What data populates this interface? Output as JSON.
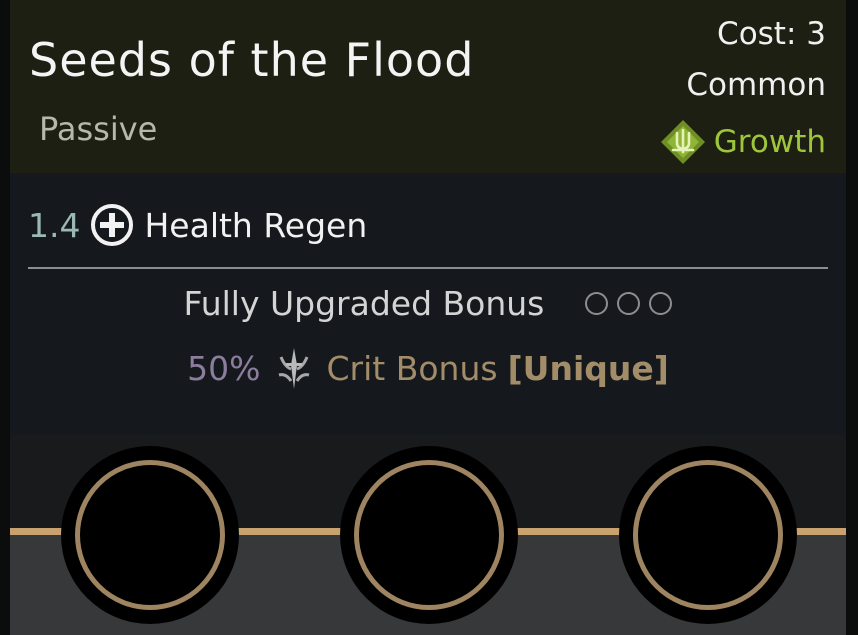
{
  "card": {
    "title": "Seeds of the Flood",
    "subtitle": "Passive",
    "cost": "Cost: 3",
    "rarity": "Common",
    "category": "Growth",
    "category_icon": "growth-icon"
  },
  "stat": {
    "value": "1.4",
    "label": "Health Regen",
    "icon": "health-plus-icon"
  },
  "bonus": {
    "title": "Fully Upgraded Bonus",
    "upgrades_total": 3,
    "upgrades_filled": 0,
    "value": "50%",
    "label": "Crit Bonus",
    "tag": "[Unique]",
    "icon": "crit-icon"
  },
  "slots": [
    {
      "name": "upgrade-slot-1"
    },
    {
      "name": "upgrade-slot-2"
    },
    {
      "name": "upgrade-slot-3"
    }
  ],
  "colors": {
    "header_bg": "#1d1f12",
    "body_bg": "#15191d",
    "growth_green": "#9fc63a",
    "stat_value": "#9cb8b4",
    "bonus_value": "#8d7d9c",
    "bonus_text": "#a38d68",
    "slot_ring": "#9e8460",
    "slot_line": "#c9a270"
  }
}
